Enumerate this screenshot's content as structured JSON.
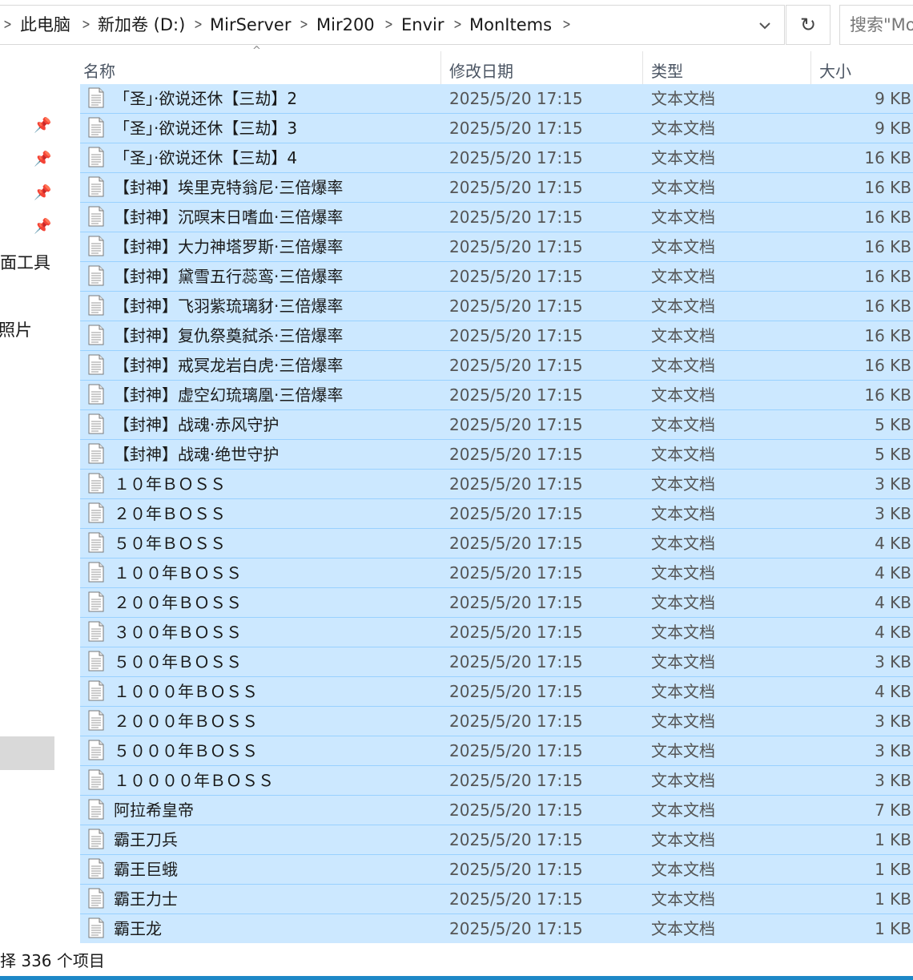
{
  "breadcrumb": {
    "items": [
      "此电脑",
      "新加卷 (D:)",
      "MirServer",
      "Mir200",
      "Envir",
      "MonItems"
    ]
  },
  "search": {
    "placeholder": "搜索\"MonItems\""
  },
  "sidebar": {
    "partial_labels": [
      "面工具",
      "照片"
    ]
  },
  "columns": {
    "name": "名称",
    "date": "修改日期",
    "type": "类型",
    "size": "大小"
  },
  "files": [
    {
      "name": "「圣」·欲说还休【三劫】2",
      "date": "2025/5/20 17:15",
      "type": "文本文档",
      "size": "9 KB"
    },
    {
      "name": "「圣」·欲说还休【三劫】3",
      "date": "2025/5/20 17:15",
      "type": "文本文档",
      "size": "9 KB"
    },
    {
      "name": "「圣」·欲说还休【三劫】4",
      "date": "2025/5/20 17:15",
      "type": "文本文档",
      "size": "16 KB"
    },
    {
      "name": "【封神】埃里克特翁尼·三倍爆率",
      "date": "2025/5/20 17:15",
      "type": "文本文档",
      "size": "16 KB"
    },
    {
      "name": "【封神】沉暝末日嗜血·三倍爆率",
      "date": "2025/5/20 17:15",
      "type": "文本文档",
      "size": "16 KB"
    },
    {
      "name": "【封神】大力神塔罗斯·三倍爆率",
      "date": "2025/5/20 17:15",
      "type": "文本文档",
      "size": "16 KB"
    },
    {
      "name": "【封神】黛雪五行蕊鸾·三倍爆率",
      "date": "2025/5/20 17:15",
      "type": "文本文档",
      "size": "16 KB"
    },
    {
      "name": "【封神】飞羽紫琉璃豺·三倍爆率",
      "date": "2025/5/20 17:15",
      "type": "文本文档",
      "size": "16 KB"
    },
    {
      "name": "【封神】复仇祭奠弑杀·三倍爆率",
      "date": "2025/5/20 17:15",
      "type": "文本文档",
      "size": "16 KB"
    },
    {
      "name": "【封神】戒冥龙岩白虎·三倍爆率",
      "date": "2025/5/20 17:15",
      "type": "文本文档",
      "size": "16 KB"
    },
    {
      "name": "【封神】虚空幻琉璃凰·三倍爆率",
      "date": "2025/5/20 17:15",
      "type": "文本文档",
      "size": "16 KB"
    },
    {
      "name": "【封神】战魂·赤风守护",
      "date": "2025/5/20 17:15",
      "type": "文本文档",
      "size": "5 KB"
    },
    {
      "name": "【封神】战魂·绝世守护",
      "date": "2025/5/20 17:15",
      "type": "文本文档",
      "size": "5 KB"
    },
    {
      "name": "１０年ＢＯＳＳ",
      "date": "2025/5/20 17:15",
      "type": "文本文档",
      "size": "3 KB"
    },
    {
      "name": "２０年ＢＯＳＳ",
      "date": "2025/5/20 17:15",
      "type": "文本文档",
      "size": "3 KB"
    },
    {
      "name": "５０年ＢＯＳＳ",
      "date": "2025/5/20 17:15",
      "type": "文本文档",
      "size": "4 KB"
    },
    {
      "name": "１００年ＢＯＳＳ",
      "date": "2025/5/20 17:15",
      "type": "文本文档",
      "size": "4 KB"
    },
    {
      "name": "２００年ＢＯＳＳ",
      "date": "2025/5/20 17:15",
      "type": "文本文档",
      "size": "4 KB"
    },
    {
      "name": "３００年ＢＯＳＳ",
      "date": "2025/5/20 17:15",
      "type": "文本文档",
      "size": "4 KB"
    },
    {
      "name": "５００年ＢＯＳＳ",
      "date": "2025/5/20 17:15",
      "type": "文本文档",
      "size": "3 KB"
    },
    {
      "name": "１０００年ＢＯＳＳ",
      "date": "2025/5/20 17:15",
      "type": "文本文档",
      "size": "4 KB"
    },
    {
      "name": "２０００年ＢＯＳＳ",
      "date": "2025/5/20 17:15",
      "type": "文本文档",
      "size": "3 KB"
    },
    {
      "name": "５０００年ＢＯＳＳ",
      "date": "2025/5/20 17:15",
      "type": "文本文档",
      "size": "3 KB"
    },
    {
      "name": "１００００年ＢＯＳＳ",
      "date": "2025/5/20 17:15",
      "type": "文本文档",
      "size": "3 KB"
    },
    {
      "name": "阿拉希皇帝",
      "date": "2025/5/20 17:15",
      "type": "文本文档",
      "size": "7 KB"
    },
    {
      "name": "霸王刀兵",
      "date": "2025/5/20 17:15",
      "type": "文本文档",
      "size": "1 KB"
    },
    {
      "name": "霸王巨蛾",
      "date": "2025/5/20 17:15",
      "type": "文本文档",
      "size": "1 KB"
    },
    {
      "name": "霸王力士",
      "date": "2025/5/20 17:15",
      "type": "文本文档",
      "size": "1 KB"
    },
    {
      "name": "霸王龙",
      "date": "2025/5/20 17:15",
      "type": "文本文档",
      "size": "1 KB"
    }
  ],
  "status": {
    "text": "择 336 个项目"
  },
  "colors": {
    "selection": "#cce8ff",
    "selection_border": "#99d1ff",
    "accent": "#1e88c7"
  },
  "icons": {
    "file": "text-document-icon",
    "pin": "pin-icon",
    "refresh": "refresh-icon",
    "dropdown": "chevron-down-icon",
    "separator": "chevron-right-icon"
  }
}
